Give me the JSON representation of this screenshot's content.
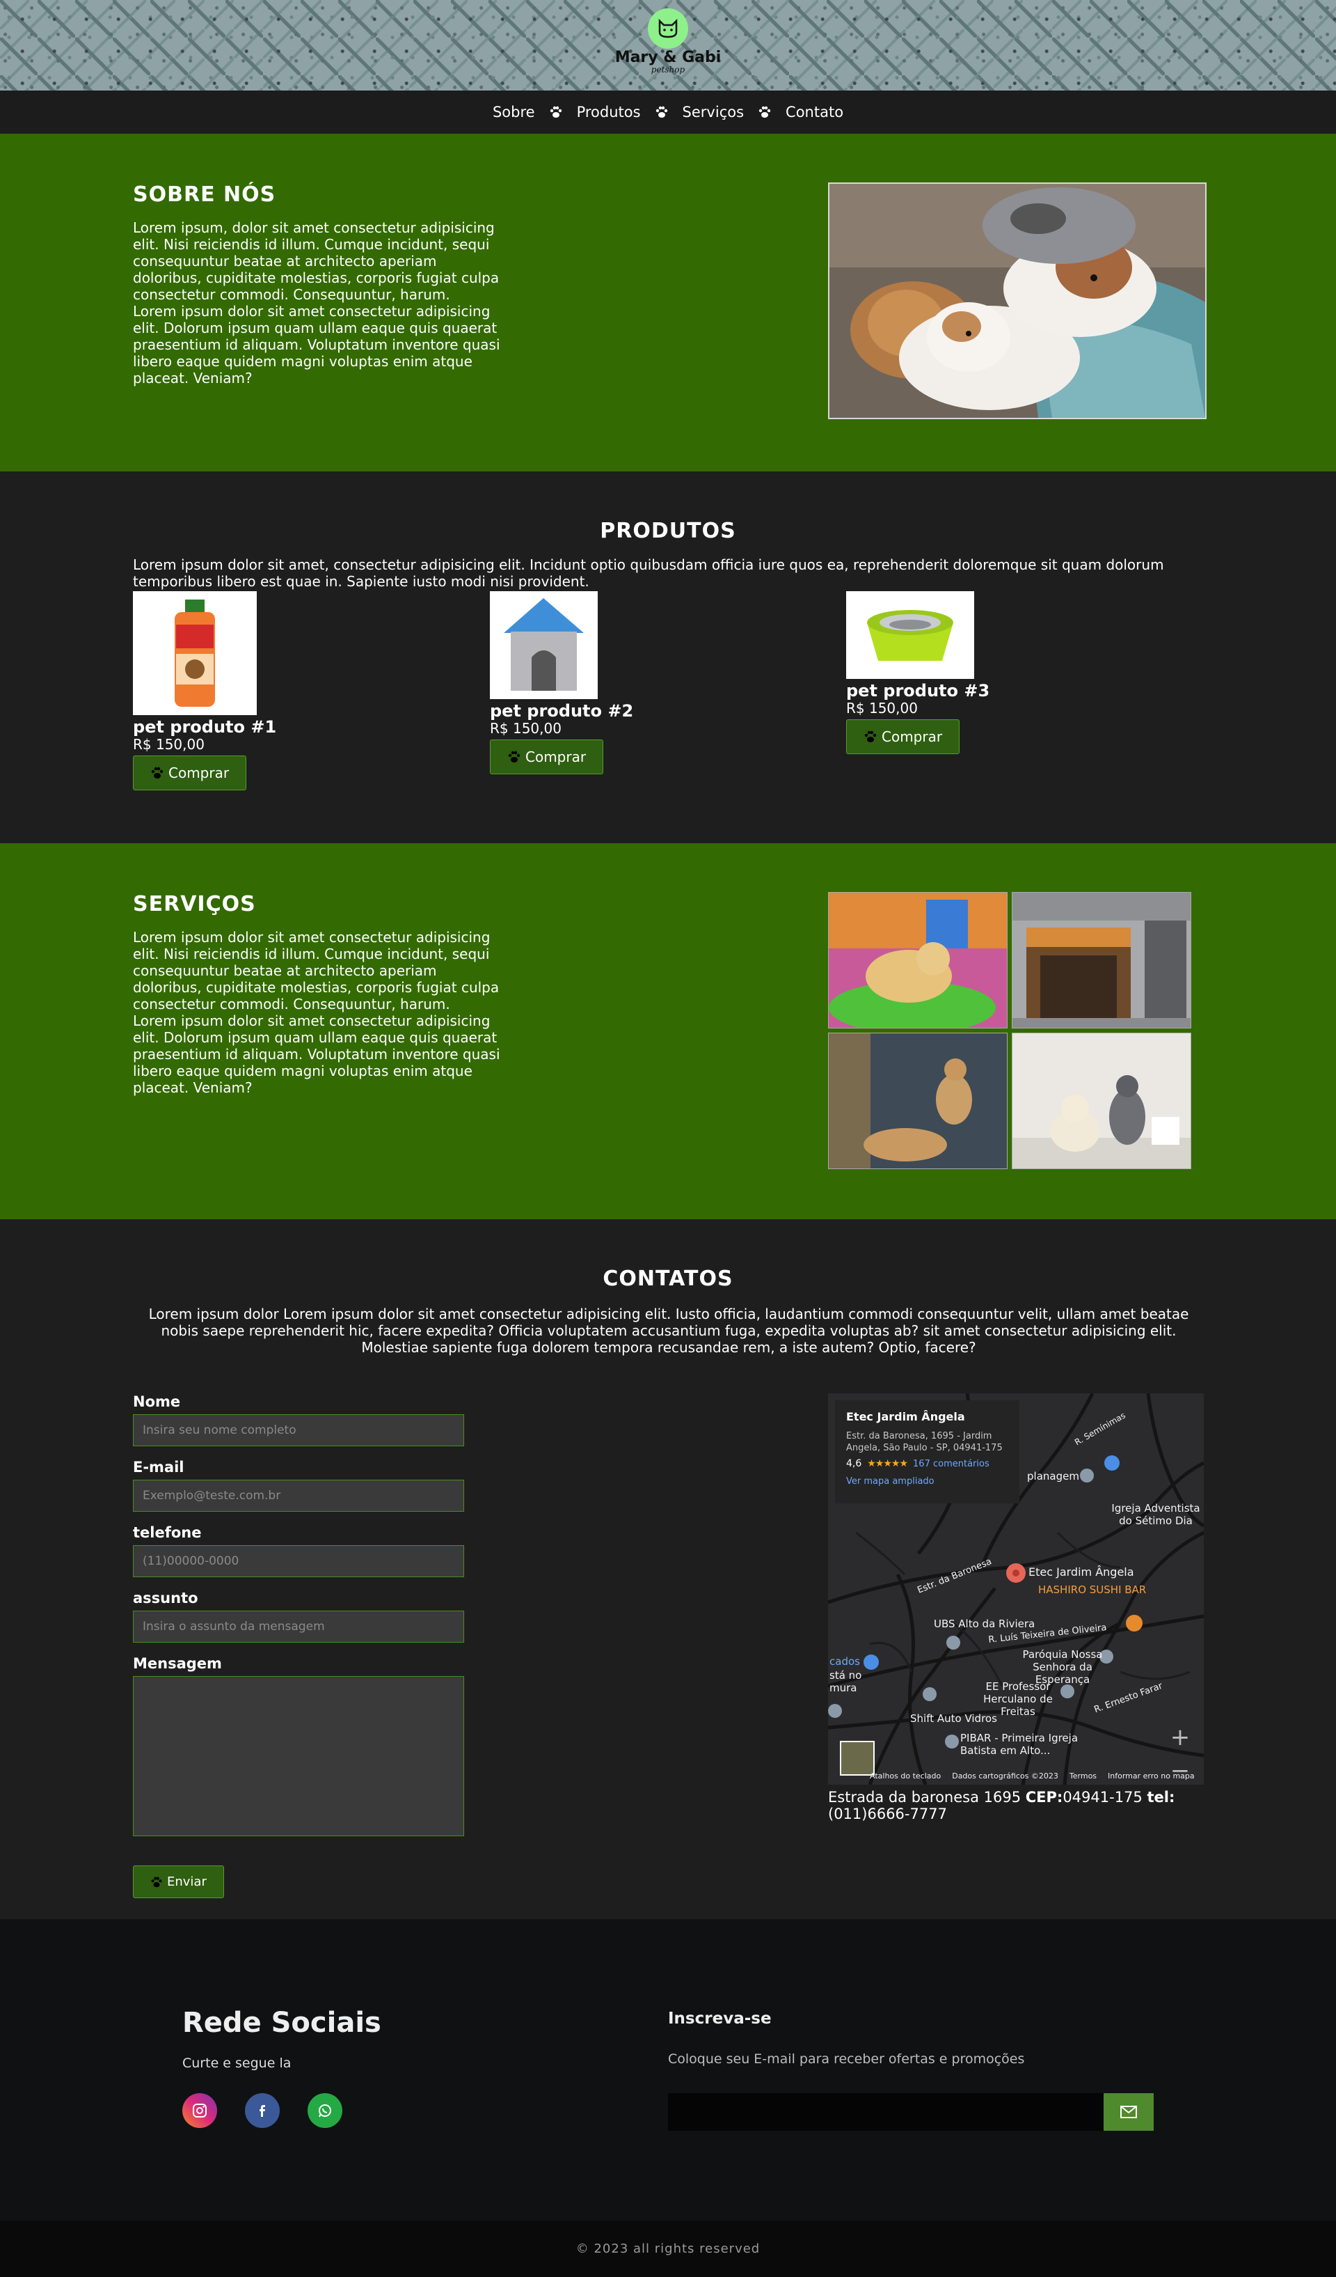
{
  "brand": {
    "name": "Mary & Gabi",
    "tagline": "petshop"
  },
  "nav": {
    "items": [
      "Sobre",
      "Produtos",
      "Serviços",
      "Contato"
    ]
  },
  "sobre": {
    "title": "SOBRE NÓS",
    "paragraphs": [
      "Lorem ipsum, dolor sit amet consectetur adipisicing elit. Nisi reiciendis id illum. Cumque incidunt, sequi consequuntur beatae at architecto aperiam doloribus, cupiditate molestias, corporis fugiat culpa consectetur commodi. Consequuntur, harum.",
      "Lorem ipsum dolor sit amet consectetur adipisicing elit. Dolorum ipsum quam ullam eaque quis quaerat praesentium id aliquam. Voluptatum inventore quasi libero eaque quidem magni voluptas enim atque placeat. Veniam?"
    ]
  },
  "produtos": {
    "title": "PRODUTOS",
    "intro": "Lorem ipsum dolor sit amet, consectetur adipisicing elit. Incidunt optio quibusdam officia iure quos ea, reprehenderit doloremque sit quam dolorum temporibus libero est quae in. Sapiente iusto modi nisi provident.",
    "items": [
      {
        "name": "pet produto #1",
        "price": "R$ 150,00",
        "button": "Comprar",
        "image": "shampoo-bottle"
      },
      {
        "name": "pet produto #2",
        "price": "R$ 150,00",
        "button": "Comprar",
        "image": "dog-house"
      },
      {
        "name": "pet produto #3",
        "price": "R$ 150,00",
        "button": "Comprar",
        "image": "pet-bowl"
      }
    ]
  },
  "servicos": {
    "title": "SERVIÇOS",
    "paragraphs": [
      "Lorem ipsum dolor sit amet consectetur adipisicing elit. Nisi reiciendis id illum. Cumque incidunt, sequi consequuntur beatae at architecto aperiam doloribus, cupiditate molestias, corporis fugiat culpa consectetur commodi. Consequuntur, harum.",
      "Lorem ipsum dolor sit amet consectetur adipisicing elit. Dolorum ipsum quam ullam eaque quis quaerat praesentium id aliquam. Voluptatum inventore quasi libero eaque quidem magni voluptas enim atque placeat. Veniam?"
    ]
  },
  "contatos": {
    "title": "CONTATOS",
    "intro": "Lorem ipsum dolor Lorem ipsum dolor sit amet consectetur adipisicing elit. Iusto officia, laudantium commodi consequuntur velit, ullam amet beatae nobis saepe reprehenderit hic, facere expedita? Officia voluptatem accusantium fuga, expedita voluptas ab? sit amet consectetur adipisicing elit. Molestiae sapiente fuga dolorem tempora recusandae rem, a iste autem? Optio, facere?",
    "form": {
      "name_label": "Nome",
      "name_placeholder": "Insira seu nome completo",
      "email_label": "E-mail",
      "email_placeholder": "Exemplo@teste.com.br",
      "phone_label": "telefone",
      "phone_placeholder": "(11)00000-0000",
      "subject_label": "assunto",
      "subject_placeholder": "Insira o assunto da mensagem",
      "message_label": "Mensagem",
      "submit": "Enviar"
    },
    "map": {
      "place": "Etec Jardim Ângela",
      "address": "Estr. da Baronesa, 1695 - Jardim Angela, São Paulo - SP, 04941-175",
      "rating": "4,6",
      "stars": "★★★★★",
      "reviews": "167 comentários",
      "link": "Ver mapa ampliado",
      "labels": {
        "pin": "Etec Jardim Ângela",
        "sushi": "HASHIRO SUSHI BAR",
        "ubs": "UBS Alto da Riviera",
        "rua": "R. Luís Teixeira de Oliveira",
        "paroquia": "Paróquia Nossa Senhora da Esperança",
        "ee": "EE Professor Herculano de Freitas",
        "shift": "Shift Auto Vidros",
        "pibar": "PIBAR - Primeira Igreja Batista em Alto...",
        "adventista": "Igreja Adventista do Sétimo Dia",
        "estr": "Estr. da Baronesa",
        "planagem": "planagem",
        "seminimas": "R. Semínimas",
        "ernesto": "R. Ernesto Farar",
        "cados": "cados",
        "stano": "stá no",
        "mura": "mura"
      },
      "attribution": [
        "Atalhos do teclado",
        "Dados cartográficos ©2023",
        "Termos",
        "Informar erro no mapa"
      ]
    },
    "address_line": {
      "street": "Estrada da baronesa 1695",
      "cep_label": "CEP:",
      "cep": "04941-175",
      "tel_label": "tel:",
      "tel": "(011)6666-7777"
    }
  },
  "footer": {
    "social_title": "Rede Sociais",
    "social_sub": "Curte e segue la",
    "social_icons": [
      "instagram-icon",
      "facebook-icon",
      "whatsapp-icon"
    ],
    "newsletter_title": "Inscreva-se",
    "newsletter_sub": "Coloque seu E-mail para receber ofertas e promoções",
    "copyright": "© 2023 all rights reserved"
  },
  "colors": {
    "green": "#336a01",
    "dark": "#1e1e1f",
    "button": "#2f5f11",
    "accent": "#8ef08a"
  }
}
